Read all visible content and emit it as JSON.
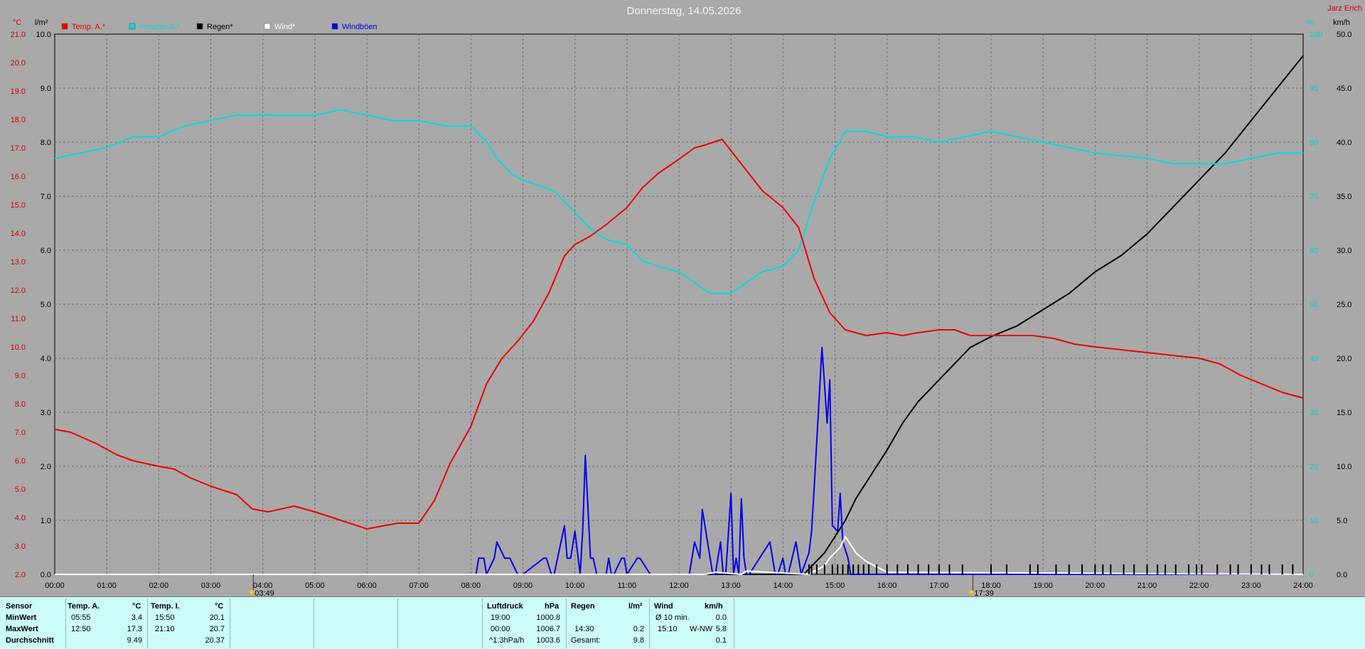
{
  "header": {
    "title": "Donnerstag, 14.05.2026",
    "brand": "Jarz Erich"
  },
  "axes": {
    "temp_unit": "°C",
    "rain_unit": "l/m²",
    "left_cyan_unit": "%",
    "wind_unit": "km/h",
    "temp_ticks": [
      "21.0",
      "20.0",
      "19.0",
      "18.0",
      "17.0",
      "16.0",
      "15.0",
      "14.0",
      "13.0",
      "12.0",
      "11.0",
      "10.0",
      "9.0",
      "8.0",
      "7.0",
      "6.0",
      "5.0",
      "4.0",
      "3.0",
      "2.0"
    ],
    "rain_ticks": [
      "10.0",
      "9.0",
      "8.0",
      "7.0",
      "6.0",
      "5.0",
      "4.0",
      "3.0",
      "2.0",
      "1.0",
      "0.0"
    ],
    "cyan_ticks": [
      "100",
      "90",
      "80",
      "70",
      "60",
      "50",
      "40",
      "30",
      "20",
      "10",
      "0"
    ],
    "wind_ticks": [
      "50.0",
      "45.0",
      "40.0",
      "35.0",
      "30.0",
      "25.0",
      "20.0",
      "15.0",
      "10.0",
      "5.0",
      "0.0"
    ],
    "time_ticks": [
      "00:00",
      "01:00",
      "02:00",
      "03:00",
      "04:00",
      "05:00",
      "06:00",
      "07:00",
      "08:00",
      "09:00",
      "10:00",
      "11:00",
      "12:00",
      "13:00",
      "14:00",
      "15:00",
      "16:00",
      "17:00",
      "18:00",
      "19:00",
      "20:00",
      "21:00",
      "22:00",
      "23:00",
      "24:00"
    ],
    "sunrise": "03:49",
    "sunset": "17:39"
  },
  "legend": [
    {
      "label": "Temp. A.*",
      "color": "#ee0000"
    },
    {
      "label": "Feuchte A.*",
      "color": "#00dddd"
    },
    {
      "label": "Regen*",
      "color": "#000000"
    },
    {
      "label": "Wind*",
      "color": "#ffffff"
    },
    {
      "label": "Windböen",
      "color": "#0000ee"
    }
  ],
  "chart_data": {
    "type": "line",
    "title": "Donnerstag, 14.05.2026",
    "x_unit": "hours",
    "xlim": [
      0,
      24
    ],
    "grid": true,
    "legend_position": "top-left",
    "series": [
      {
        "name": "Temp. A.*",
        "unit": "°C",
        "axis": "temp",
        "ylim": [
          2,
          21
        ],
        "color": "#ee0000",
        "x": [
          0,
          0.3,
          0.8,
          1.2,
          1.5,
          2.0,
          2.3,
          2.6,
          3.0,
          3.5,
          3.8,
          4.1,
          4.6,
          5.0,
          5.5,
          6.0,
          6.3,
          6.6,
          7.0,
          7.3,
          7.6,
          8.0,
          8.3,
          8.6,
          8.9,
          9.2,
          9.5,
          9.8,
          10.0,
          10.3,
          10.6,
          11.0,
          11.3,
          11.6,
          12.0,
          12.3,
          12.5,
          12.83,
          13.0,
          13.3,
          13.6,
          14.0,
          14.3,
          14.6,
          14.9,
          15.2,
          15.6,
          16.0,
          16.3,
          16.6,
          17.0,
          17.3,
          17.6,
          18.0,
          18.4,
          18.8,
          19.2,
          19.6,
          20.0,
          20.5,
          21.0,
          21.5,
          22.0,
          22.4,
          22.8,
          23.2,
          23.6,
          24.0
        ],
        "y": [
          7.1,
          7.0,
          6.6,
          6.2,
          6.0,
          5.8,
          5.7,
          5.4,
          5.1,
          4.8,
          4.3,
          4.2,
          4.4,
          4.2,
          3.9,
          3.6,
          3.7,
          3.8,
          3.8,
          4.6,
          5.9,
          7.2,
          8.7,
          9.6,
          10.2,
          10.9,
          11.9,
          13.2,
          13.6,
          13.9,
          14.3,
          14.9,
          15.6,
          16.1,
          16.6,
          17.0,
          17.1,
          17.3,
          16.9,
          16.2,
          15.5,
          14.9,
          14.2,
          12.4,
          11.2,
          10.6,
          10.4,
          10.5,
          10.4,
          10.5,
          10.6,
          10.6,
          10.4,
          10.4,
          10.4,
          10.4,
          10.3,
          10.1,
          10.0,
          9.9,
          9.8,
          9.7,
          9.6,
          9.4,
          9.0,
          8.7,
          8.4,
          8.2
        ]
      },
      {
        "name": "Feuchte A.*",
        "unit": "%",
        "axis": "cyan",
        "ylim": [
          0,
          100
        ],
        "color": "#00dddd",
        "x": [
          0,
          0.5,
          1.0,
          1.5,
          2.0,
          2.5,
          3.0,
          3.5,
          4.0,
          4.5,
          5.0,
          5.5,
          6.0,
          6.5,
          7.0,
          7.5,
          8.0,
          8.3,
          8.5,
          8.8,
          9.0,
          9.3,
          9.6,
          10.0,
          10.3,
          10.6,
          11.0,
          11.3,
          11.6,
          12.0,
          12.3,
          12.6,
          13.0,
          13.3,
          13.6,
          14.0,
          14.3,
          14.6,
          14.9,
          15.2,
          15.6,
          16.0,
          16.5,
          17.0,
          17.5,
          18.0,
          18.5,
          19.0,
          19.5,
          20.0,
          21.0,
          21.5,
          22.0,
          22.5,
          23.0,
          23.5,
          24.0
        ],
        "y": [
          77,
          78,
          79,
          81,
          81,
          83,
          84,
          85,
          85,
          85,
          85,
          86,
          85,
          84,
          84,
          83,
          83,
          80,
          77,
          74,
          73,
          72,
          71,
          67,
          64,
          62,
          61,
          58,
          57,
          56,
          54,
          52,
          52,
          54,
          56,
          57,
          60,
          69,
          77,
          82,
          82,
          81,
          81,
          80,
          81,
          82,
          81,
          80,
          79,
          78,
          77,
          76,
          76,
          76,
          77,
          78,
          78
        ]
      },
      {
        "name": "Regen*",
        "unit": "l/m²",
        "axis": "rain",
        "ylim": [
          0,
          10
        ],
        "color": "#000000",
        "x": [
          0,
          14.4,
          14.6,
          14.8,
          15.0,
          15.2,
          15.4,
          15.6,
          15.8,
          16.0,
          16.3,
          16.6,
          17.0,
          17.3,
          17.6,
          18.0,
          18.5,
          19.0,
          19.5,
          20.0,
          20.5,
          21.0,
          21.5,
          22.0,
          22.5,
          23.0,
          23.5,
          24.0
        ],
        "y": [
          0,
          0,
          0.2,
          0.4,
          0.7,
          1.0,
          1.4,
          1.7,
          2.0,
          2.3,
          2.8,
          3.2,
          3.6,
          3.9,
          4.2,
          4.4,
          4.6,
          4.9,
          5.2,
          5.6,
          5.9,
          6.3,
          6.8,
          7.3,
          7.8,
          8.4,
          9.0,
          9.6
        ]
      },
      {
        "name": "Wind*",
        "unit": "km/h",
        "axis": "wind",
        "ylim": [
          0,
          50
        ],
        "color": "#ffffff",
        "x": [
          0,
          12.5,
          12.7,
          13.2,
          13.3,
          14.5,
          14.8,
          14.9,
          15.0,
          15.1,
          15.2,
          15.4,
          15.6,
          15.8,
          16.0,
          24.0
        ],
        "y": [
          0,
          0,
          0.2,
          0,
          0.3,
          0,
          0.8,
          1.5,
          2.0,
          2.5,
          3.5,
          2.0,
          1.2,
          0.7,
          0.2,
          0
        ]
      },
      {
        "name": "Windböen",
        "unit": "km/h",
        "axis": "wind",
        "ylim": [
          0,
          50
        ],
        "color": "#0000ee",
        "x": [
          0,
          8.1,
          8.15,
          8.25,
          8.3,
          8.45,
          8.5,
          8.65,
          8.75,
          8.9,
          9.0,
          9.4,
          9.45,
          9.55,
          9.6,
          9.8,
          9.85,
          9.92,
          10.0,
          10.1,
          10.15,
          10.2,
          10.3,
          10.35,
          10.42,
          10.6,
          10.65,
          10.7,
          10.75,
          10.9,
          10.95,
          11.0,
          11.2,
          11.25,
          11.45,
          11.5,
          12.2,
          12.25,
          12.3,
          12.4,
          12.45,
          12.55,
          12.6,
          12.65,
          12.7,
          12.8,
          12.85,
          12.9,
          13.0,
          13.05,
          13.1,
          13.15,
          13.2,
          13.25,
          13.3,
          13.35,
          13.75,
          13.85,
          13.9,
          14.0,
          14.05,
          14.1,
          14.25,
          14.3,
          14.35,
          14.5,
          14.55,
          14.6,
          14.75,
          14.85,
          14.9,
          14.95,
          15.05,
          15.1,
          15.15,
          15.25,
          15.3,
          15.4,
          15.5,
          24.0
        ],
        "y": [
          0,
          0,
          1.5,
          1.5,
          0,
          1.5,
          3.0,
          1.5,
          1.5,
          0,
          0,
          1.5,
          1.5,
          0,
          0,
          4.5,
          1.5,
          1.5,
          4.0,
          0,
          4.0,
          11.0,
          1.5,
          1.5,
          0,
          0,
          1.5,
          0,
          0,
          1.5,
          1.5,
          0,
          1.5,
          1.5,
          0,
          0,
          0,
          1.5,
          3.0,
          1.5,
          6.0,
          3.0,
          1.5,
          0,
          0,
          3.0,
          0,
          0,
          7.5,
          0,
          1.5,
          0,
          7.0,
          1.5,
          0,
          0,
          3.0,
          0,
          0,
          1.5,
          0,
          0,
          3.0,
          1.5,
          0,
          2.0,
          4.0,
          8.0,
          21.0,
          14.0,
          18.0,
          4.5,
          4.0,
          7.5,
          3.0,
          1.5,
          0,
          0,
          0,
          0
        ]
      }
    ],
    "rain_ticks_x": [
      14.5,
      14.55,
      14.65,
      14.8,
      14.95,
      15.05,
      15.15,
      15.25,
      15.35,
      15.45,
      15.55,
      15.65,
      15.8,
      16.0,
      16.2,
      16.4,
      16.6,
      16.8,
      17.0,
      17.2,
      17.45,
      18.0,
      18.3,
      18.75,
      18.9,
      19.25,
      19.5,
      19.75,
      20.0,
      20.15,
      20.3,
      20.55,
      20.75,
      21.0,
      21.2,
      21.35,
      21.55,
      21.8,
      21.95,
      22.05,
      22.35,
      22.6,
      22.75,
      23.0,
      23.2,
      23.35,
      23.6,
      23.8
    ]
  },
  "stats": {
    "header": {
      "sensor": "Sensor",
      "temp_a": "Temp. A.",
      "temp_a_unit": "°C",
      "temp_i": "Temp. I.",
      "temp_i_unit": "°C",
      "pressure": "Luftdruck",
      "pressure_unit": "hPa",
      "rain": "Regen",
      "rain_unit": "l/m²",
      "wind": "Wind",
      "wind_unit": "km/h"
    },
    "rows": [
      {
        "label": "MinWert",
        "ta_time": "05:55",
        "ta_val": "3.4",
        "ti_time": "15:50",
        "ti_val": "20.1",
        "p_time": "19:00",
        "p_val": "1000.8",
        "r_time": "",
        "r_val": "",
        "w_time": "Ø 10 min.",
        "w_dir": "",
        "w_val": "0.0"
      },
      {
        "label": "MaxWert",
        "ta_time": "12:50",
        "ta_val": "17.3",
        "ti_time": "21:10",
        "ti_val": "20.7",
        "p_time": "00:00",
        "p_val": "1006.7",
        "r_time": "14:30",
        "r_val": "0.2",
        "w_time": "15:10",
        "w_dir": "W-NW",
        "w_val": "5.8"
      },
      {
        "label": "Durchschnitt",
        "ta_time": "",
        "ta_val": "9.49",
        "ti_time": "",
        "ti_val": "20.37",
        "p_time": "^1.3hPa/h",
        "p_val": "1003.6",
        "r_time": "Gesamt:",
        "r_val": "9.8",
        "w_time": "",
        "w_dir": "",
        "w_val": "0.1"
      }
    ]
  }
}
